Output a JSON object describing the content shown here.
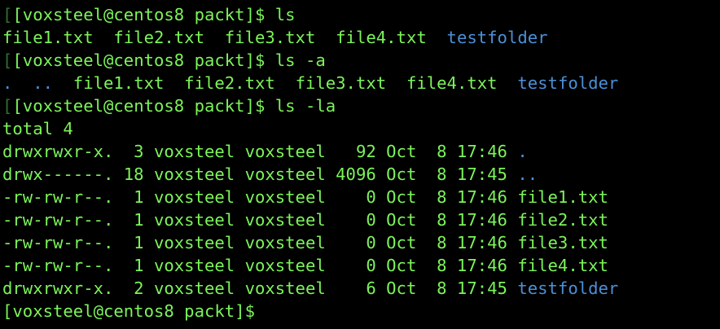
{
  "terminal": {
    "colors": {
      "background": "#000000",
      "text": "#7cf35a",
      "directory": "#4c8fd6",
      "dim_bracket": "#2e6f2e"
    },
    "lines": [
      {
        "type": "prompt",
        "mark": "[",
        "prompt": "[voxsteel@centos8 packt]$ ",
        "command": "ls"
      },
      {
        "type": "output",
        "parts": [
          {
            "text": "file1.txt  file2.txt  file3.txt  file4.txt  ",
            "kind": "file"
          },
          {
            "text": "testfolder",
            "kind": "dir"
          }
        ]
      },
      {
        "type": "prompt",
        "mark": "[",
        "prompt": "[voxsteel@centos8 packt]$ ",
        "command": "ls -a"
      },
      {
        "type": "output",
        "parts": [
          {
            "text": ".  ..  ",
            "kind": "dir"
          },
          {
            "text": "file1.txt  file2.txt  file3.txt  file4.txt  ",
            "kind": "file"
          },
          {
            "text": "testfolder",
            "kind": "dir"
          }
        ]
      },
      {
        "type": "prompt",
        "mark": "[",
        "prompt": "[voxsteel@centos8 packt]$ ",
        "command": "ls -la"
      },
      {
        "type": "output",
        "parts": [
          {
            "text": "total 4",
            "kind": "file"
          }
        ]
      },
      {
        "type": "output",
        "parts": [
          {
            "text": "drwxrwxr-x.  3 voxsteel voxsteel   92 Oct  8 17:46 ",
            "kind": "file"
          },
          {
            "text": ".",
            "kind": "dir"
          }
        ]
      },
      {
        "type": "output",
        "parts": [
          {
            "text": "drwx------. 18 voxsteel voxsteel 4096 Oct  8 17:45 ",
            "kind": "file"
          },
          {
            "text": "..",
            "kind": "dir"
          }
        ]
      },
      {
        "type": "output",
        "parts": [
          {
            "text": "-rw-rw-r--.  1 voxsteel voxsteel    0 Oct  8 17:46 file1.txt",
            "kind": "file"
          }
        ]
      },
      {
        "type": "output",
        "parts": [
          {
            "text": "-rw-rw-r--.  1 voxsteel voxsteel    0 Oct  8 17:46 file2.txt",
            "kind": "file"
          }
        ]
      },
      {
        "type": "output",
        "parts": [
          {
            "text": "-rw-rw-r--.  1 voxsteel voxsteel    0 Oct  8 17:46 file3.txt",
            "kind": "file"
          }
        ]
      },
      {
        "type": "output",
        "parts": [
          {
            "text": "-rw-rw-r--.  1 voxsteel voxsteel    0 Oct  8 17:46 file4.txt",
            "kind": "file"
          }
        ]
      },
      {
        "type": "output",
        "parts": [
          {
            "text": "drwxrwxr-x.  2 voxsteel voxsteel    6 Oct  8 17:45 ",
            "kind": "file"
          },
          {
            "text": "testfolder",
            "kind": "dir"
          }
        ]
      },
      {
        "type": "prompt",
        "mark": "",
        "prompt": "[voxsteel@centos8 packt]$",
        "command": ""
      }
    ]
  }
}
